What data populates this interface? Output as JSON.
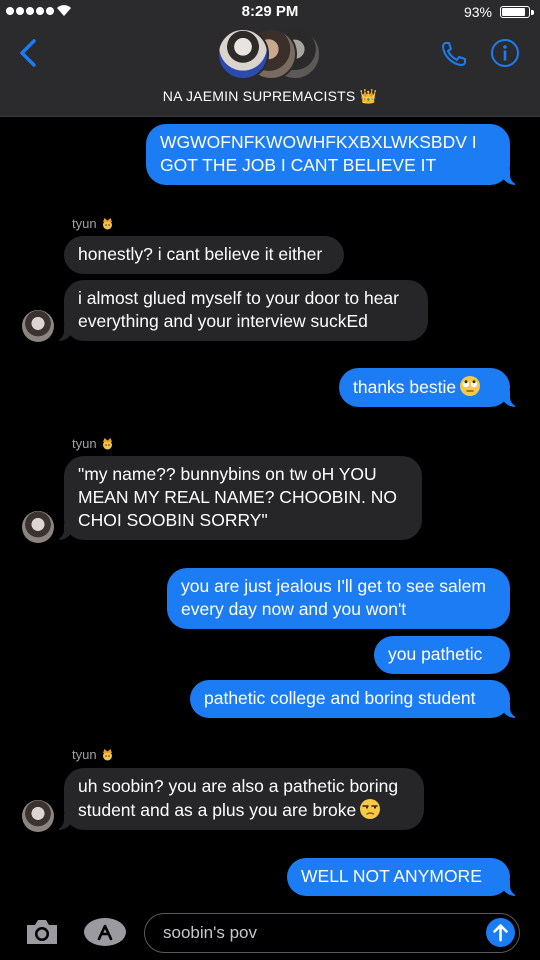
{
  "status_bar": {
    "time": "8:29 PM",
    "battery_pct": "93%",
    "battery_level": 0.93
  },
  "header": {
    "group_name": "NA JAEMIN SUPREMACISTS 👑"
  },
  "messages": [
    {
      "type": "sent",
      "text": "WGWOFNFKWOWHFKXBXLWKSBDV I GOT THE JOB I CANT BELIEVE IT"
    },
    {
      "type": "sender_label",
      "text": "tyun"
    },
    {
      "type": "received",
      "text": "honestly? i cant believe it either"
    },
    {
      "type": "received",
      "text": "i almost glued myself to your door to hear everything and your interview suckEd"
    },
    {
      "type": "sent",
      "text": "thanks bestie",
      "emoji": "face-with-rolling-eyes"
    },
    {
      "type": "sender_label",
      "text": "tyun"
    },
    {
      "type": "received",
      "text": "\"my name?? bunnybins on tw oH YOU MEAN MY REAL NAME? CHOOBIN. NO CHOI SOOBIN SORRY\""
    },
    {
      "type": "sent",
      "text": "you are just jealous I'll get to see salem every day now and you won't"
    },
    {
      "type": "sent",
      "text": "you pathetic"
    },
    {
      "type": "sent",
      "text": "pathetic college and boring student"
    },
    {
      "type": "sender_label",
      "text": "tyun"
    },
    {
      "type": "received",
      "text": "uh soobin? you are also a pathetic boring student and as a plus you are broke",
      "emoji": "unamused-face"
    },
    {
      "type": "sent",
      "text": "WELL NOT ANYMORE"
    }
  ],
  "input": {
    "placeholder": "soobin's pov"
  },
  "colors": {
    "sent_bubble": "#1c7cf4",
    "received_bubble": "#262628",
    "accent": "#1c7cf4"
  },
  "icons": [
    "back-chevron-icon",
    "phone-icon",
    "info-icon",
    "camera-icon",
    "app-store-icon",
    "send-arrow-icon",
    "crown-emoji-icon"
  ]
}
